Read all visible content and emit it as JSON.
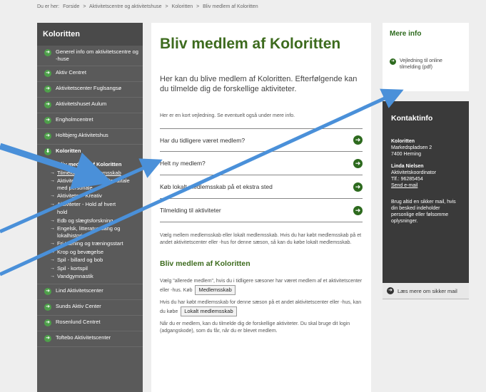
{
  "breadcrumb": {
    "prefix": "Du er her:",
    "items": [
      "Forside",
      ">",
      "Aktivitetscentre og aktivitetshuse",
      ">",
      "Koloritten",
      ">",
      "Bliv medlem af Koloritten"
    ]
  },
  "sidebar": {
    "title": "Koloritten",
    "items_top": [
      "Generel info om aktivitetscentre og -huse",
      "Aktiv Centret",
      "Aktivitetscenter Fuglsangsø",
      "Aktivitetshuset Aulum",
      "Engholmcentret",
      "Holtbjerg Aktivitetshus",
      "Koloritten"
    ],
    "sub_items": [
      "Bliv medlem af Koloritten",
      "Tilmelding til medlemsskab",
      "Aktivitet og træning efter aftale med personale",
      "Aktiviteter - Kreativ",
      "Aktiviteter - Hold af hvert",
      "hold",
      "Edb og slægtsforskning",
      "Engelsk, litteratur, sang og lokalhistorie",
      "Fri træning og træningsstart",
      "Krop og bevægelse",
      "Spil - billard og bob",
      "Spil - kortspil",
      "Vandgymnastik"
    ],
    "items_bottom": [
      "Lind Aktivitetscenter",
      "Sunds Aktiv Center",
      "Rosenlund Centret",
      "Toftebo Aktivitetscenter"
    ]
  },
  "main": {
    "title": "Bliv medlem af Koloritten",
    "intro": "Her kan du blive medlem af Koloritten. Efterfølgende kan du tilmelde dig de forskellige aktiviteter.",
    "guide_text": "Her er en kort vejledning. Se eventuelt også under mere info.",
    "faq": [
      "Har du tidligere været medlem?",
      "Helt ny medlem?",
      "Køb lokalt medlemsskab på et ekstra sted",
      "Tilmelding til aktiviteter"
    ],
    "choose_text": "Vælg mellem medlemsskab eller lokalt medlemsskab. Hvis du har købt medlemsskab på et andet aktivitetscenter eller -hus for denne sæson, så kan du købe lokalt medlemsskab.",
    "section_title": "Bliv medlem af Koloritten",
    "p1": "Vælg \"allerede medlem\", hvis du i tidligere sæsoner har været medlem af et aktivitetscenter eller -hus. Køb",
    "btn1": "Medlemsskab",
    "p2": "Hvis du har købt medlemsskab for denne sæson på et andet aktivitetscenter eller -hus, kan du købe",
    "btn2": "Lokalt medlemsskab",
    "p3": "Når du er medlem, kan du tilmelde dig de forskellige aktiviteter. Du skal bruge dit login (adgangskode), som du får, når du er blevet medlem."
  },
  "right": {
    "mere_title": "Mere info",
    "mere_link": "Vejledning til online tilmelding (pdf)",
    "kontakt_title": "Kontaktinfo",
    "org": "Koloritten",
    "addr1": "Markedspladsen 2",
    "addr2": "7400 Herning",
    "person": "Linda Nielsen",
    "role": "Aktivitetskoordinator",
    "phone": "Tlf.: 96285454",
    "email": "Send e-mail",
    "secure_text": "Brug altid en sikker mail, hvis din besked indeholder personlige eller følsomme oplysninger.",
    "secure_link": "Læs mere om sikker mail"
  },
  "colors": {
    "arrow": "#4a90d9",
    "accent_green": "#3d6b1e",
    "bullet_green": "#4ea04a"
  }
}
